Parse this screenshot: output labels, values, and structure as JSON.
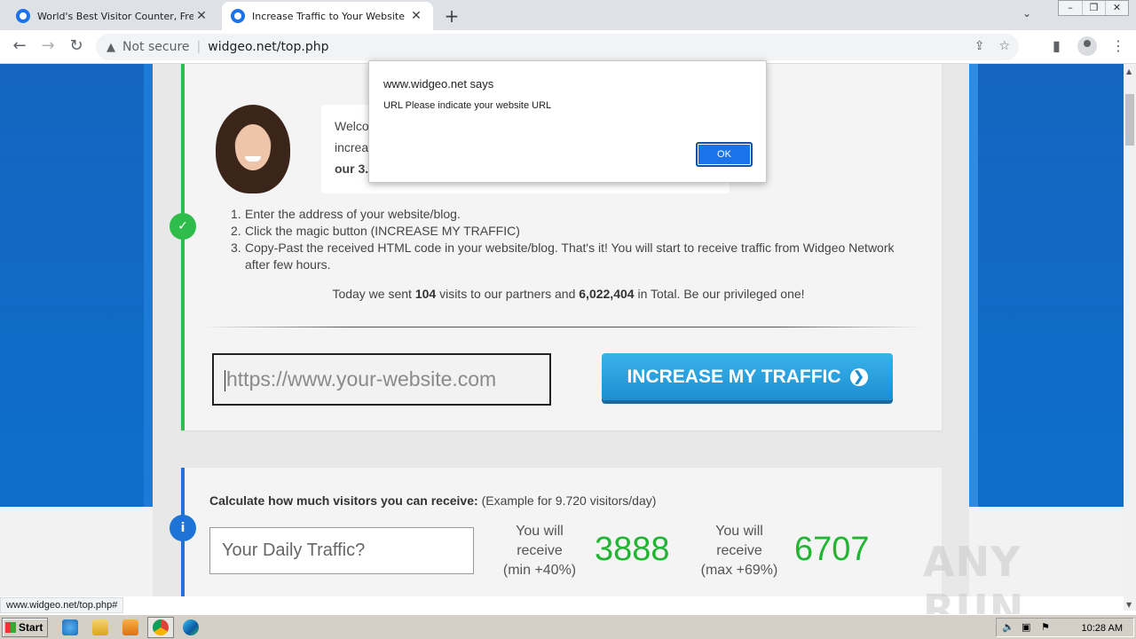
{
  "browser": {
    "tabs": [
      {
        "title": "World's Best Visitor Counter, Free hi"
      },
      {
        "title": "Increase Traffic to Your Website by"
      }
    ],
    "new_tab_label": "+",
    "security_label": "Not secure",
    "url": "widgeo.net/top.php",
    "status_url": "www.widgeo.net/top.php#"
  },
  "dialog": {
    "origin": "www.widgeo.net says",
    "message": "URL Please indicate your website URL",
    "ok_label": "OK"
  },
  "intro": {
    "bubble_lines": [
      "Welco",
      "increa",
      "our 3."
    ]
  },
  "steps": [
    {
      "num": "1.",
      "text": "Enter the address of your website/blog."
    },
    {
      "num": "2.",
      "text": "Click the magic button (INCREASE MY TRAFFIC)"
    },
    {
      "num": "3.",
      "text": "Copy-Past the received HTML code in your website/blog. That's it! You will start to receive traffic from Widgeo Network after few hours."
    }
  ],
  "today": {
    "prefix": "Today we sent",
    "visits": "104",
    "middle": "visits to our partners and",
    "total": "6,022,404",
    "suffix": "in Total. Be our privileged one!"
  },
  "form": {
    "url_placeholder": "https://www.your-website.com",
    "cta_label": "INCREASE MY TRAFFIC",
    "cta_arrow": "❯"
  },
  "calculator": {
    "title": "Calculate how much visitors you can receive:",
    "example": "(Example for 9.720 visitors/day)",
    "input_placeholder": "Your Daily Traffic?",
    "min_label": [
      "You will",
      "receive",
      "(min +40%)"
    ],
    "min_value": "3888",
    "max_label": [
      "You will",
      "receive",
      "(max +69%)"
    ],
    "max_value": "6707"
  },
  "watermark": "ANY RUN",
  "taskbar": {
    "start_label": "Start",
    "time": "10:28 AM"
  },
  "colors": {
    "page_blue": "#1565c0",
    "green_accent": "#2ebd4b",
    "cta_blue": "#1b8fd2",
    "big_number_green": "#22b533"
  }
}
